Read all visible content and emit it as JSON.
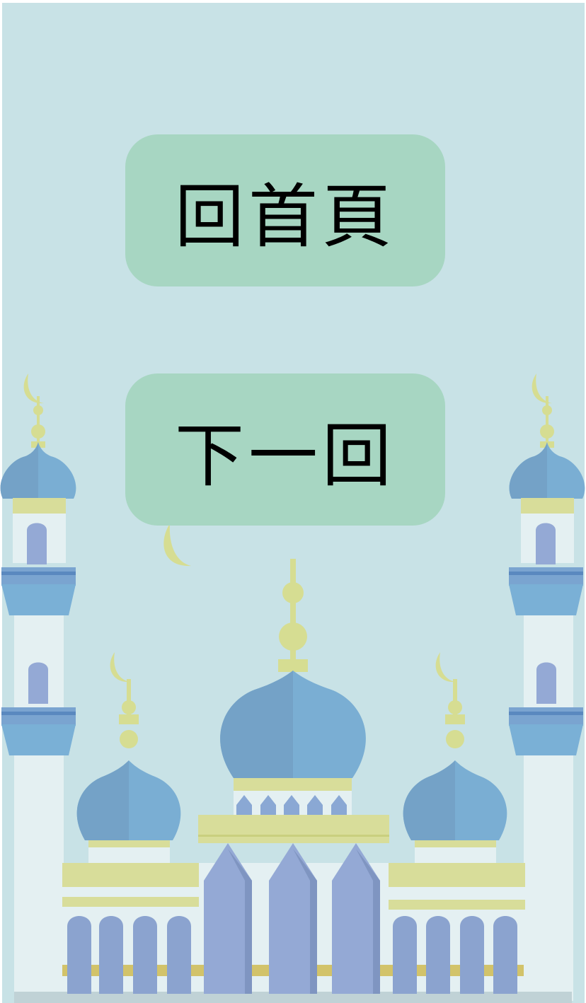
{
  "menu": {
    "home_label": "回首頁",
    "next_label": "下一回"
  },
  "colors": {
    "background": "#c8e2e6",
    "button": "#a7d6c2",
    "dome": "#7aaed3",
    "dome_shade": "#74a2c7",
    "window": "#94a9d5",
    "gold": "#d8dd9a",
    "wall": "#e4f0f2"
  },
  "illustration": {
    "subject": "mosque-illustration"
  }
}
